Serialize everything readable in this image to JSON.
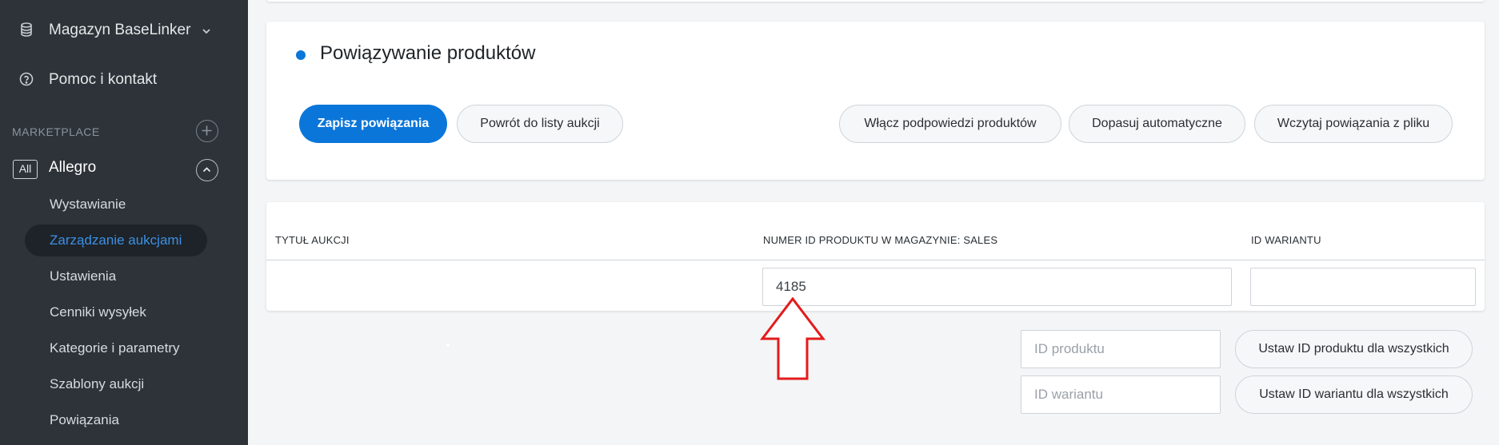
{
  "sidebar": {
    "warehouse_label": "Magazyn BaseLinker",
    "help_label": "Pomoc i kontakt",
    "section_label": "MARKETPLACE",
    "all_badge": "All",
    "allegro_label": "Allegro",
    "items": [
      {
        "label": "Wystawianie",
        "active": false
      },
      {
        "label": "Zarządzanie aukcjami",
        "active": true
      },
      {
        "label": "Ustawienia",
        "active": false
      },
      {
        "label": "Cenniki wysyłek",
        "active": false
      },
      {
        "label": "Kategorie i parametry",
        "active": false
      },
      {
        "label": "Szablony aukcji",
        "active": false
      },
      {
        "label": "Powiązania",
        "active": false
      }
    ]
  },
  "header": {
    "title": "Powiązywanie produktów"
  },
  "toolbar": {
    "save_label": "Zapisz powiązania",
    "back_label": "Powrót do listy aukcji",
    "hints_label": "Włącz podpowiedzi produktów",
    "auto_label": "Dopasuj automatyczne",
    "load_file_label": "Wczytaj powiązania z pliku"
  },
  "table": {
    "columns": [
      "TYTUŁ AUKCJI",
      "NUMER ID PRODUKTU W MAGAZYNIE: SALES",
      "ID WARIANTU"
    ],
    "rows": [
      {
        "title": "",
        "product_id": "4185",
        "variant_id": ""
      }
    ]
  },
  "bulk": {
    "product_id_placeholder": "ID produktu",
    "variant_id_placeholder": "ID wariantu",
    "set_product_label": "Ustaw ID produktu dla wszystkich",
    "set_variant_label": "Ustaw ID wariantu dla wszystkich"
  },
  "colors": {
    "primary": "#0b76d9",
    "sidebar_bg": "#2d3338",
    "active_link": "#3d8fe6",
    "annotation_arrow": "#e31b1b"
  }
}
